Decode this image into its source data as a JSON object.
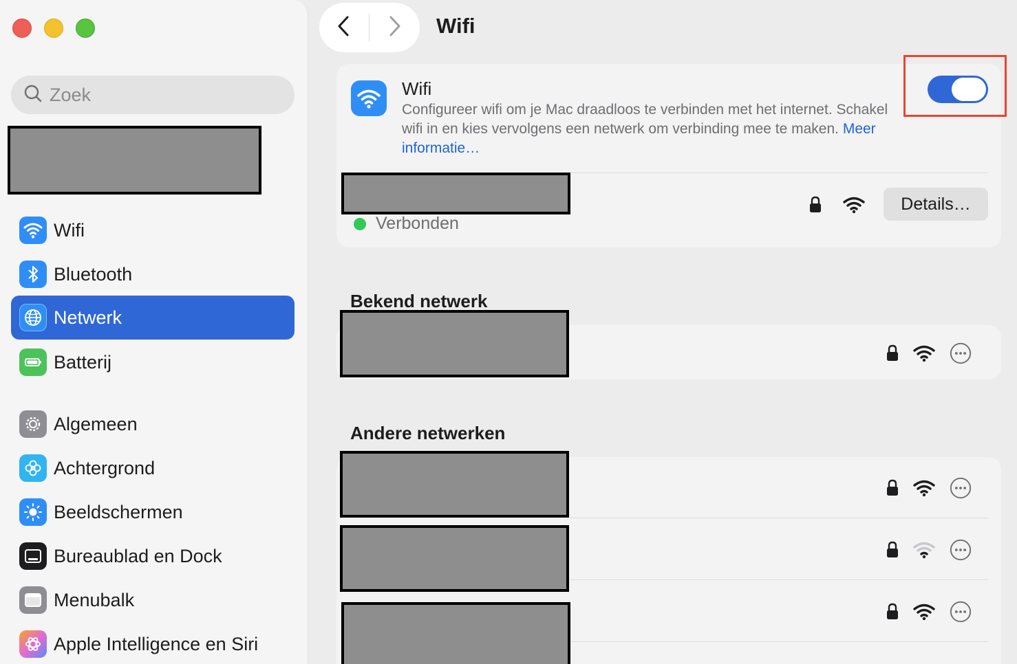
{
  "window": {
    "title": "Wifi"
  },
  "sidebar": {
    "search": {
      "placeholder": "Zoek"
    },
    "items": [
      {
        "label": "Wifi",
        "icon": "wifi-icon",
        "color": "#2f8ef6"
      },
      {
        "label": "Bluetooth",
        "icon": "bluetooth-icon",
        "color": "#2f8ef6"
      },
      {
        "label": "Netwerk",
        "icon": "globe-icon",
        "color": "#2f8ef6",
        "active": true
      },
      {
        "label": "Batterij",
        "icon": "battery-icon",
        "color": "#4cc35a"
      },
      {
        "label": "Algemeen",
        "icon": "gear-icon",
        "color": "#8e8e93"
      },
      {
        "label": "Achtergrond",
        "icon": "flower-icon",
        "color": "#32b4f0"
      },
      {
        "label": "Beeldschermen",
        "icon": "sun-icon",
        "color": "#2f8ef6"
      },
      {
        "label": "Bureaublad en Dock",
        "icon": "dock-icon",
        "color": "#1d1d1f"
      },
      {
        "label": "Menubalk",
        "icon": "menubar-icon",
        "color": "#8e8e93"
      },
      {
        "label": "Apple Intelligence en Siri",
        "icon": "siri-icon",
        "color": "#e36bd0"
      }
    ]
  },
  "main": {
    "wifi_card": {
      "title": "Wifi",
      "description": "Configureer wifi om je Mac draadloos te verbinden met het internet. Schakel wifi in en kies vervolgens een netwerk om verbinding mee te maken.",
      "link": "Meer informatie…",
      "enabled": true,
      "connected_status": "Verbonden",
      "details_label": "Details…"
    },
    "known_networks_title": "Bekend netwerk",
    "other_networks_title": "Andere netwerken"
  },
  "colors": {
    "accent": "#2f67d7",
    "highlight": "#e8462f",
    "connected": "#34c759"
  }
}
